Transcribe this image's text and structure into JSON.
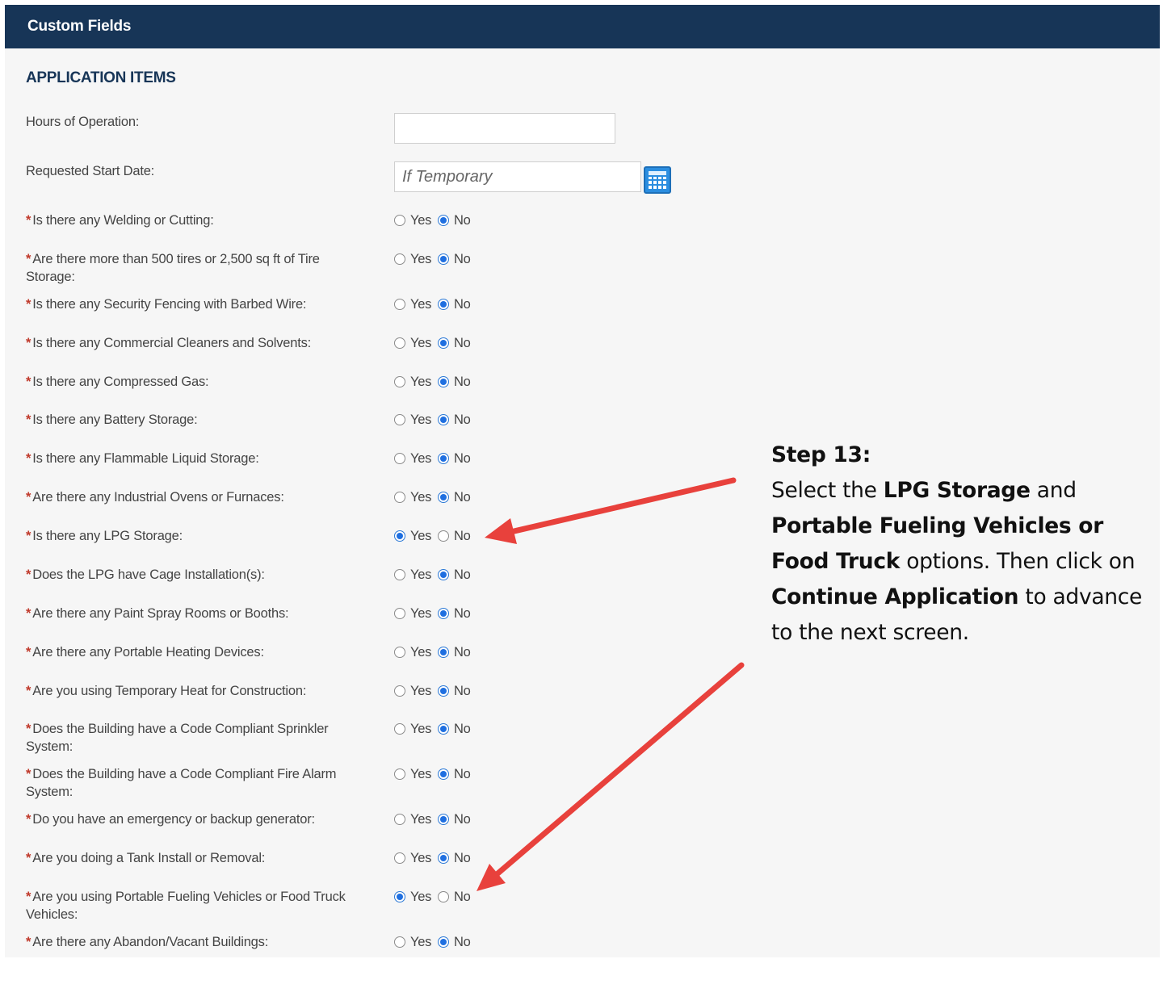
{
  "header": {
    "title": "Custom Fields"
  },
  "section": {
    "title": "APPLICATION ITEMS"
  },
  "fields": {
    "hours": {
      "label": "Hours of Operation:",
      "value": ""
    },
    "start_date": {
      "label": "Requested Start Date:",
      "placeholder": "If Temporary"
    }
  },
  "radio_labels": {
    "yes": "Yes",
    "no": "No"
  },
  "questions": [
    {
      "line1": "Is there any Welding or Cutting:",
      "line2": "",
      "answer": "No"
    },
    {
      "line1": "Are there more than 500 tires or 2,500 sq ft of Tire",
      "line2": "Storage:",
      "answer": "No"
    },
    {
      "line1": "Is there any Security Fencing with Barbed Wire:",
      "line2": "",
      "answer": "No"
    },
    {
      "line1": "Is there any Commercial Cleaners and Solvents:",
      "line2": "",
      "answer": "No"
    },
    {
      "line1": "Is there any Compressed Gas:",
      "line2": "",
      "answer": "No"
    },
    {
      "line1": "Is there any Battery Storage:",
      "line2": "",
      "answer": "No"
    },
    {
      "line1": "Is there any Flammable Liquid Storage:",
      "line2": "",
      "answer": "No"
    },
    {
      "line1": "Are there any Industrial Ovens or Furnaces:",
      "line2": "",
      "answer": "No"
    },
    {
      "line1": "Is there any LPG Storage:",
      "line2": "",
      "answer": "Yes"
    },
    {
      "line1": "Does the LPG have Cage Installation(s):",
      "line2": "",
      "answer": "No"
    },
    {
      "line1": "Are there any Paint Spray Rooms or Booths:",
      "line2": "",
      "answer": "No"
    },
    {
      "line1": "Are there any Portable Heating Devices:",
      "line2": "",
      "answer": "No"
    },
    {
      "line1": "Are you using Temporary Heat for Construction:",
      "line2": "",
      "answer": "No"
    },
    {
      "line1": "Does the Building have a Code Compliant Sprinkler",
      "line2": "System:",
      "answer": "No"
    },
    {
      "line1": "Does the Building have a Code Compliant Fire Alarm",
      "line2": "System:",
      "answer": "No"
    },
    {
      "line1": "Do you have an emergency or backup generator:",
      "line2": "",
      "answer": "No"
    },
    {
      "line1": "Are you doing a Tank Install or Removal:",
      "line2": "",
      "answer": "No"
    },
    {
      "line1": "Are you using Portable Fueling Vehicles or Food Truck",
      "line2": "Vehicles:",
      "answer": "Yes"
    },
    {
      "line1": "Are there any Abandon/Vacant Buildings:",
      "line2": "",
      "answer": "No"
    }
  ],
  "note": {
    "title": "Step 13:",
    "t1": "Select the ",
    "b1": "LPG Storage",
    "t2": " and ",
    "b2": "Portable Fueling Vehicles or Food Truck",
    "t3": " options. Then click on ",
    "b3": "Continue Application",
    "t4": " to advance to the next screen."
  },
  "colors": {
    "header_bg": "#173557",
    "section_title": "#173557",
    "required_asterisk": "#c0392b",
    "radio_selected": "#1f6fe0",
    "annotation_arrow": "#e8413c"
  },
  "icons": {
    "date_picker": "calendar-icon"
  }
}
